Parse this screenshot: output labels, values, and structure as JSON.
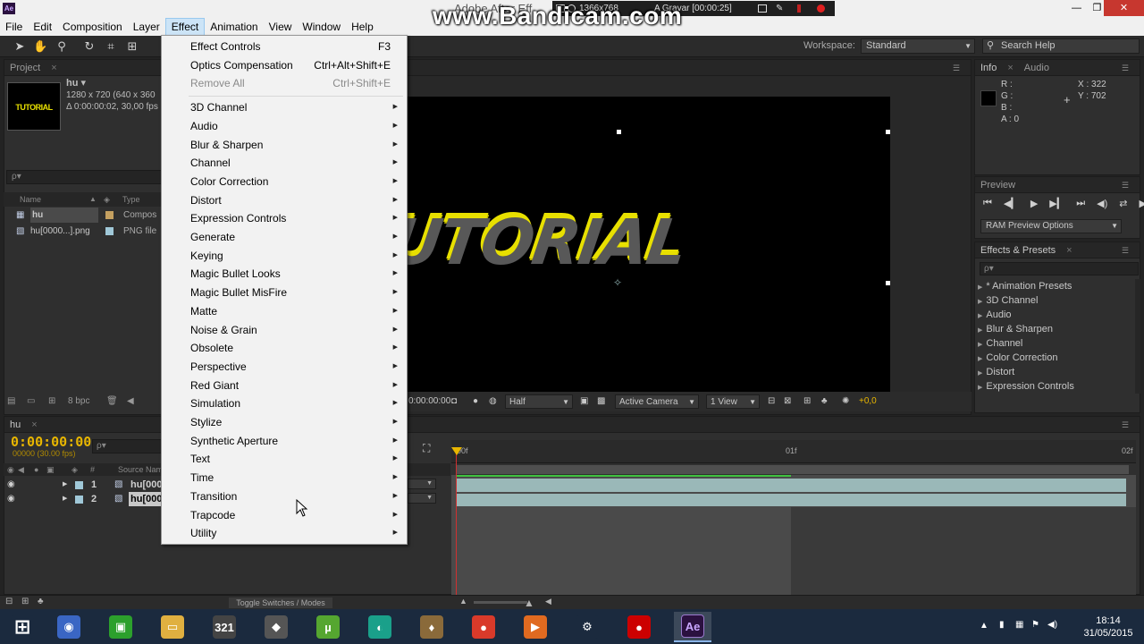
{
  "window": {
    "app_icon": "Ae",
    "title": "Adobe After Eff",
    "bandicam_watermark": "www.Bandicam.com",
    "recording_resolution": "1366x768",
    "recording_status": "A Gravar [00:00:25]",
    "controls": {
      "minimize": "—",
      "maximize": "❐",
      "close": "✕"
    }
  },
  "menubar": [
    "File",
    "Edit",
    "Composition",
    "Layer",
    "Effect",
    "Animation",
    "View",
    "Window",
    "Help"
  ],
  "menubar_active": "Effect",
  "toolbar": {
    "workspace_label": "Workspace:",
    "workspace_value": "Standard",
    "search_placeholder": "Search Help"
  },
  "project_panel": {
    "tab": "Project",
    "thumb_text": "TUTORIAL",
    "comp_name": "hu ▾",
    "comp_size": "1280 x 720  (640 x 360",
    "comp_duration": "Δ 0:00:00:02, 30,00 fps",
    "search_placeholder": "ρ▾",
    "col_name": "Name",
    "col_type": "Type",
    "items": [
      {
        "name": "hu",
        "type": "Compos",
        "swatch": "#c4a060"
      },
      {
        "name": "hu[0000...].png",
        "type": "PNG file",
        "swatch": "#a0c8d8"
      }
    ],
    "bpc": "8 bpc"
  },
  "comp_viewer": {
    "text": "TUTORIAL",
    "timecode": "0:00:00:00",
    "resolution": "Half",
    "camera": "Active Camera",
    "view": "1 View",
    "exposure": "+0,0"
  },
  "info_panel": {
    "tabs": [
      "Info",
      "Audio"
    ],
    "r": "R :",
    "g": "G :",
    "b": "B :",
    "a": "A : 0",
    "x": "X : 322",
    "y": "Y : 702"
  },
  "preview_panel": {
    "tab": "Preview",
    "ram_preview": "RAM Preview Options"
  },
  "effects_presets_panel": {
    "tab": "Effects & Presets",
    "search_placeholder": "ρ▾",
    "items": [
      "* Animation Presets",
      "3D Channel",
      "Audio",
      "Blur & Sharpen",
      "Channel",
      "Color Correction",
      "Distort",
      "Expression Controls"
    ]
  },
  "timeline": {
    "tab": "hu",
    "timecode": "0:00:00:00",
    "fps": "00000 (30.00 fps)",
    "search_placeholder": "ρ▾",
    "col_num": "#",
    "col_source": "Source Name",
    "layers": [
      {
        "num": "1",
        "name": "hu[000"
      },
      {
        "num": "2",
        "name": "hu[000"
      }
    ],
    "ruler": [
      "00f",
      "01f",
      "02f"
    ],
    "toggle": "Toggle Switches / Modes"
  },
  "effect_menu": [
    {
      "label": "Effect Controls",
      "shortcut": "F3",
      "disabled": false,
      "submenu": false
    },
    {
      "label": "Optics Compensation",
      "shortcut": "Ctrl+Alt+Shift+E",
      "disabled": false,
      "submenu": false
    },
    {
      "label": "Remove All",
      "shortcut": "Ctrl+Shift+E",
      "disabled": true,
      "submenu": false
    },
    {
      "label": "3D Channel",
      "submenu": true
    },
    {
      "label": "Audio",
      "submenu": true
    },
    {
      "label": "Blur & Sharpen",
      "submenu": true
    },
    {
      "label": "Channel",
      "submenu": true
    },
    {
      "label": "Color Correction",
      "submenu": true
    },
    {
      "label": "Distort",
      "submenu": true
    },
    {
      "label": "Expression Controls",
      "submenu": true
    },
    {
      "label": "Generate",
      "submenu": true
    },
    {
      "label": "Keying",
      "submenu": true
    },
    {
      "label": "Magic Bullet Looks",
      "submenu": true
    },
    {
      "label": "Magic Bullet MisFire",
      "submenu": true
    },
    {
      "label": "Matte",
      "submenu": true
    },
    {
      "label": "Noise & Grain",
      "submenu": true
    },
    {
      "label": "Obsolete",
      "submenu": true
    },
    {
      "label": "Perspective",
      "submenu": true
    },
    {
      "label": "Red Giant",
      "submenu": true
    },
    {
      "label": "Simulation",
      "submenu": true
    },
    {
      "label": "Stylize",
      "submenu": true
    },
    {
      "label": "Synthetic Aperture",
      "submenu": true
    },
    {
      "label": "Text",
      "submenu": true
    },
    {
      "label": "Time",
      "submenu": true
    },
    {
      "label": "Transition",
      "submenu": true
    },
    {
      "label": "Trapcode",
      "submenu": true
    },
    {
      "label": "Utility",
      "submenu": true
    }
  ],
  "taskbar": {
    "apps": [
      {
        "name": "windows-start",
        "glyph": "⊞",
        "color": "#1b2a3e"
      },
      {
        "name": "app-globe",
        "glyph": "◉",
        "color": "#3a66c4"
      },
      {
        "name": "app-green",
        "glyph": "▣",
        "color": "#2ca02c"
      },
      {
        "name": "file-explorer",
        "glyph": "▭",
        "color": "#e0b040"
      },
      {
        "name": "app-calendar",
        "glyph": "321",
        "color": "#444"
      },
      {
        "name": "app-shield",
        "glyph": "◆",
        "color": "#555"
      },
      {
        "name": "utorrent",
        "glyph": "µ",
        "color": "#55a630"
      },
      {
        "name": "app-teal",
        "glyph": "◐",
        "color": "#1aa08a"
      },
      {
        "name": "app-figure",
        "glyph": "♦",
        "color": "#8a6a3a"
      },
      {
        "name": "chrome",
        "glyph": "●",
        "color": "#d93a2a"
      },
      {
        "name": "media-player",
        "glyph": "▶",
        "color": "#e06a20"
      },
      {
        "name": "steam",
        "glyph": "⚙",
        "color": "#1b2a3e"
      },
      {
        "name": "bandicam",
        "glyph": "●",
        "color": "#c00"
      },
      {
        "name": "after-effects",
        "glyph": "Ae",
        "color": "#2b1140"
      }
    ],
    "time": "18:14",
    "date": "31/05/2015"
  }
}
